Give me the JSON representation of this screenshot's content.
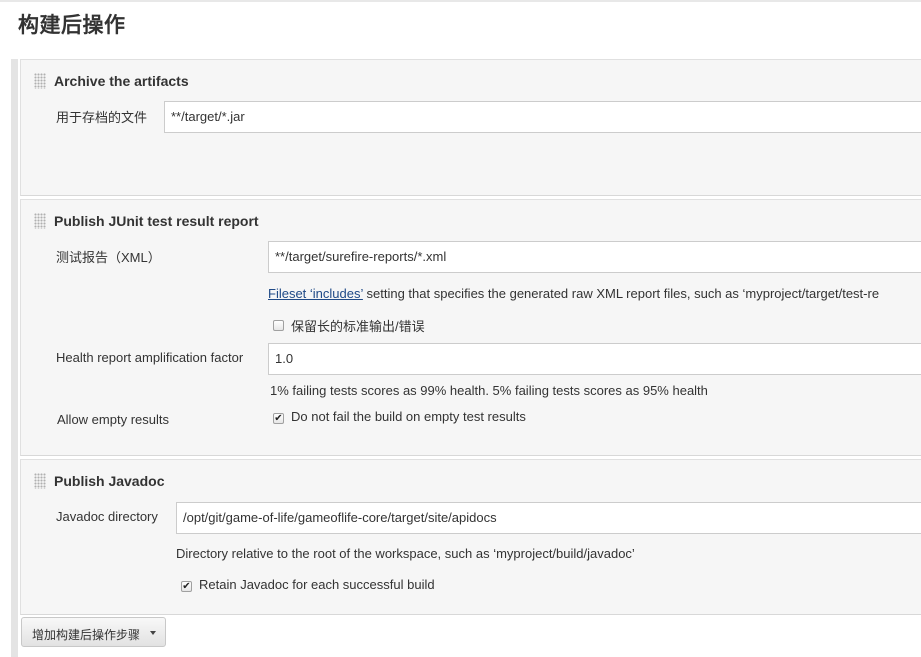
{
  "page": {
    "title": "构建后操作"
  },
  "archive": {
    "title": "Archive the artifacts",
    "files_label": "用于存档的文件",
    "files_value": "**/target/*.jar"
  },
  "junit": {
    "title": "Publish JUnit test result report",
    "xml_label": "测试报告（XML）",
    "xml_value": "**/target/surefire-reports/*.xml",
    "fileset_link": "Fileset ‘includes’",
    "fileset_help": " setting that specifies the generated raw XML report files, such as ‘myproject/target/test-re",
    "keep_long_stdio_label": "保留长的标准输出/错误",
    "keep_long_stdio_checked": false,
    "health_label": "Health report amplification factor",
    "health_value": "1.0",
    "health_help": "1% failing tests scores as 99% health. 5% failing tests scores as 95% health",
    "allow_empty_label": "Allow empty results",
    "allow_empty_checkbox_label": "Do not fail the build on empty test results",
    "allow_empty_checked": true
  },
  "javadoc": {
    "title": "Publish Javadoc",
    "dir_label": "Javadoc directory",
    "dir_value": "/opt/git/game-of-life/gameoflife-core/target/site/apidocs",
    "dir_help": "Directory relative to the root of the workspace, such as ‘myproject/build/javadoc’",
    "retain_label": "Retain Javadoc for each successful build",
    "retain_checked": true
  },
  "add_step_button": {
    "label": "增加构建后操作步骤"
  },
  "checkmark": "✔"
}
